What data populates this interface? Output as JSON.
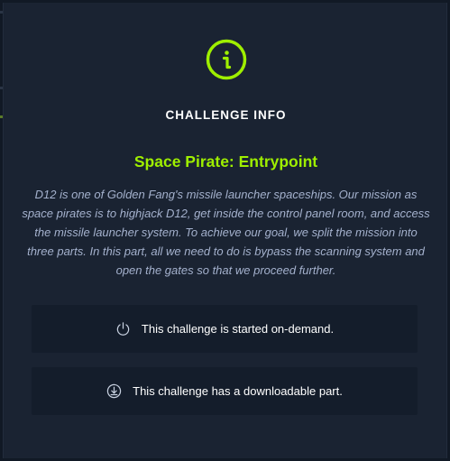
{
  "modal": {
    "icon": "info-circle-icon",
    "heading": "CHALLENGE INFO",
    "title": "Space Pirate: Entrypoint",
    "description": "D12 is one of Golden Fang's missile launcher spaceships. Our mission as space pirates is to highjack D12, get inside the control panel room, and access the missile launcher system. To achieve our goal, we split the mission into three parts. In this part, all we need to do is bypass the scanning system and open the gates so that we proceed further.",
    "notices": [
      {
        "icon": "power-icon",
        "text": "This challenge is started on-demand."
      },
      {
        "icon": "download-icon",
        "text": "This challenge has a downloadable part."
      }
    ]
  },
  "colors": {
    "accent": "#9fef00",
    "background": "#1a2332",
    "notice_background": "#141d2b",
    "description_text": "#a4b1cd"
  }
}
